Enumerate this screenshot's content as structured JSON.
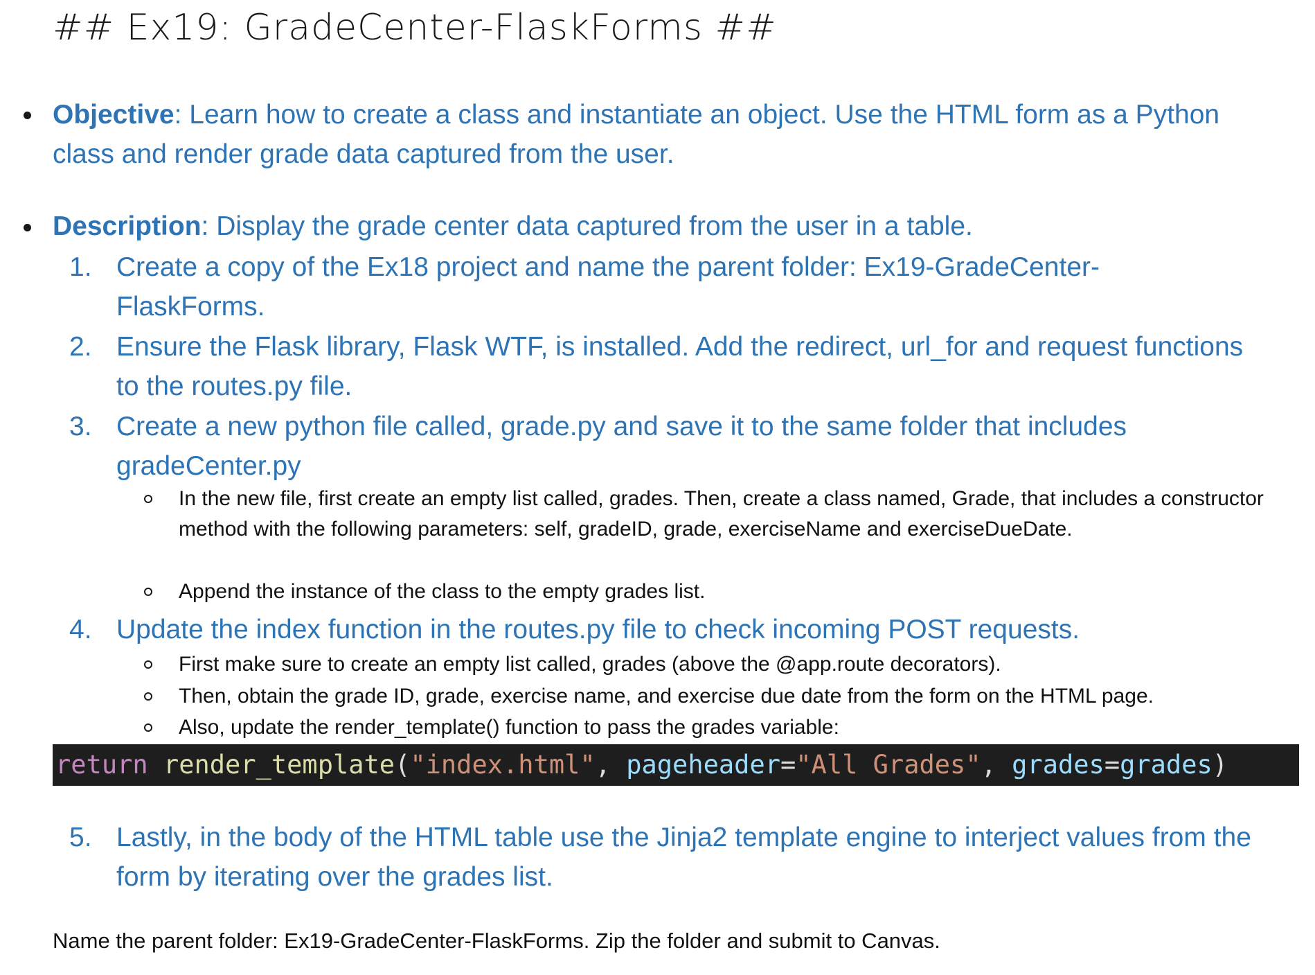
{
  "title": "## Ex19: GradeCenter-FlaskForms ##",
  "objective": {
    "label": "Objective",
    "text": ": Learn how to create a class and instantiate an object. Use the HTML form as a Python class and render grade data captured from the user."
  },
  "description": {
    "label": "Description",
    "text": ": Display the grade center data captured from the user in a table."
  },
  "steps": [
    {
      "num": "1.",
      "text": "Create a copy of the Ex18 project and name the parent folder: Ex19-GradeCenter-FlaskForms."
    },
    {
      "num": "2.",
      "text": "Ensure the Flask library, Flask WTF, is installed. Add the redirect, url_for and request functions to the routes.py file."
    },
    {
      "num": "3.",
      "text": "Create a new python file called, grade.py and save it to the same folder that includes gradeCenter.py",
      "subs": [
        "In the new file, first create an empty list called, grades. Then, create a class named, Grade, that includes a constructor method with the following parameters: self, gradeID, grade, exerciseName and exerciseDueDate.",
        "Append the instance of the class to the empty grades list."
      ]
    },
    {
      "num": "4.",
      "text": "Update the index function in the routes.py file to check incoming POST requests.",
      "subs": [
        "First make sure to create an empty list called, grades (above the @app.route decorators).",
        "Then, obtain the grade ID, grade, exercise name, and exercise due date from the form on the HTML page.",
        "Also, update the render_template() function to pass the grades variable:"
      ]
    },
    {
      "num": "5.",
      "text": "Lastly, in the body of the HTML table use the Jinja2 template engine to interject values from the form by iterating over the grades list."
    }
  ],
  "code": {
    "keyword": "return",
    "func": "render_template",
    "open": "(",
    "arg1": "\"index.html\"",
    "comma1": ", ",
    "param1": "pageheader",
    "eq1": "=",
    "arg2": "\"All Grades\"",
    "comma2": ", ",
    "param2": "grades",
    "eq2": "=",
    "arg3": "grades",
    "close": ")"
  },
  "footer": "Name the parent folder: Ex19-GradeCenter-FlaskForms.  Zip the folder and submit to Canvas."
}
